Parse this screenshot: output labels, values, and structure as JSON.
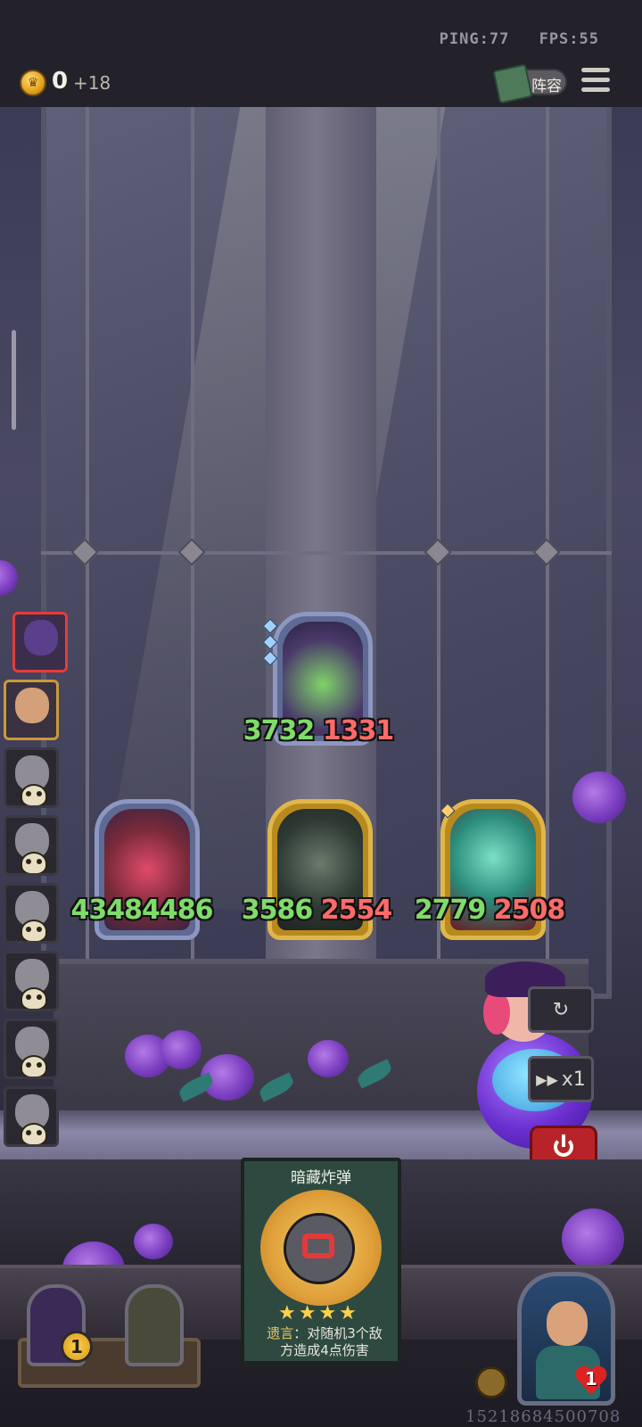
{
  "status": {
    "ping": "PING:77",
    "fps": "FPS:55"
  },
  "resources": {
    "gold": "0",
    "gold_income": "+18"
  },
  "buttons": {
    "lineup": "阵容",
    "speed": "x1"
  },
  "colors": {
    "attack": "#7fdc6a",
    "health": "#ff6a6a",
    "gold_frame": "#e0b64a",
    "silver_frame": "#8d98c2",
    "selected": "#e53b3b"
  },
  "enemy_board": [
    {
      "name": "snake-dragon",
      "atk": "3732",
      "hp": "1331",
      "frame": "silver"
    }
  ],
  "player_board": [
    {
      "name": "clown",
      "atk": "4348",
      "hp": "4486",
      "frame": "silver"
    },
    {
      "name": "skull-reaper",
      "atk": "3586",
      "hp": "2554",
      "frame": "gold"
    },
    {
      "name": "ghost",
      "atk": "2779",
      "hp": "2508",
      "frame": "gold"
    }
  ],
  "players_sidebar": [
    {
      "state": "current-opponent"
    },
    {
      "state": "self"
    },
    {
      "state": "eliminated"
    },
    {
      "state": "eliminated"
    },
    {
      "state": "eliminated"
    },
    {
      "state": "eliminated"
    },
    {
      "state": "eliminated"
    },
    {
      "state": "eliminated"
    }
  ],
  "spell_card": {
    "title": "暗藏炸弹",
    "stars": 4,
    "stars_text": "★★★★",
    "desc_keyword": "遗言",
    "desc_line1": "：对随机3个敌",
    "desc_line2": "方造成4点伤害"
  },
  "shop": {
    "tier": "1"
  },
  "my_hero": {
    "health": "1"
  },
  "user_id": "15218684500708"
}
